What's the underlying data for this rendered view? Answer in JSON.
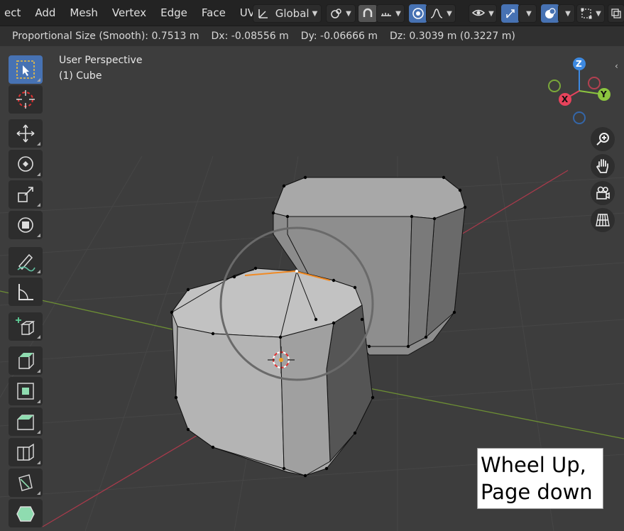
{
  "header": {
    "menu": [
      "ect",
      "Add",
      "Mesh",
      "Vertex",
      "Edge",
      "Face",
      "UV"
    ],
    "transform_orientation": "Global"
  },
  "status": {
    "proportional_size": "Proportional Size (Smooth): 0.7513 m",
    "dx": "Dx: -0.08556 m",
    "dy": "Dy: -0.06666 m",
    "dz": "Dz: 0.3039 m (0.3227 m)"
  },
  "viewport": {
    "view_name": "User Perspective",
    "object_name": "(1) Cube",
    "gizmo": {
      "x": "X",
      "y": "Y",
      "z": "Z"
    }
  },
  "overlay": {
    "line1": "Wheel Up,",
    "line2": "Page down"
  },
  "colors": {
    "active_tool": "#4772b3",
    "x_axis": "#e8435c",
    "y_axis": "#8cc63f",
    "z_axis": "#3d89e0",
    "selection": "#f08a24"
  },
  "toolbar_icons": [
    "select-box-icon",
    "cursor-icon",
    "move-icon",
    "rotate-icon",
    "scale-icon",
    "transform-icon",
    "annotate-icon",
    "measure-icon",
    "add-cube-icon",
    "extrude-icon",
    "inset-icon",
    "bevel-icon",
    "loop-cut-icon",
    "knife-icon",
    "poly-build-icon"
  ],
  "nav_icons": [
    "zoom-icon",
    "pan-hand-icon",
    "camera-icon",
    "ortho-grid-icon"
  ]
}
